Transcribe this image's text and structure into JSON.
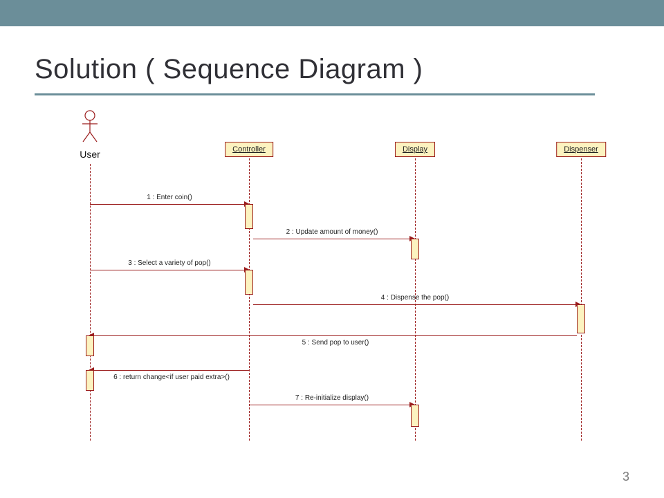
{
  "slide": {
    "title": "Solution ( Sequence Diagram )",
    "page_number": "3"
  },
  "diagram": {
    "actor": "User",
    "participants": {
      "controller": "Controller",
      "display": "Display",
      "dispenser": "Dispenser"
    },
    "messages": {
      "m1": "1 : Enter coin()",
      "m2": "2 : Update amount of money()",
      "m3": "3 : Select a variety of pop()",
      "m4": "4 : Dispense the pop()",
      "m5": "5 : Send pop to user()",
      "m6": "6 : return change<if user paid extra>()",
      "m7": "7 : Re-initialize display()"
    }
  },
  "chart_data": {
    "type": "sequence_diagram",
    "title": "Solution ( Sequence Diagram )",
    "actors": [
      "User"
    ],
    "objects": [
      "Controller",
      "Display",
      "Dispenser"
    ],
    "messages": [
      {
        "seq": 1,
        "from": "User",
        "to": "Controller",
        "label": "Enter coin()"
      },
      {
        "seq": 2,
        "from": "Controller",
        "to": "Display",
        "label": "Update amount of money()"
      },
      {
        "seq": 3,
        "from": "User",
        "to": "Controller",
        "label": "Select a variety of pop()"
      },
      {
        "seq": 4,
        "from": "Controller",
        "to": "Dispenser",
        "label": "Dispense the pop()"
      },
      {
        "seq": 5,
        "from": "Dispenser",
        "to": "User",
        "label": "Send pop to user()"
      },
      {
        "seq": 6,
        "from": "Controller",
        "to": "User",
        "label": "return change<if user paid extra>()"
      },
      {
        "seq": 7,
        "from": "Controller",
        "to": "Display",
        "label": "Re-initialize display()"
      }
    ]
  }
}
